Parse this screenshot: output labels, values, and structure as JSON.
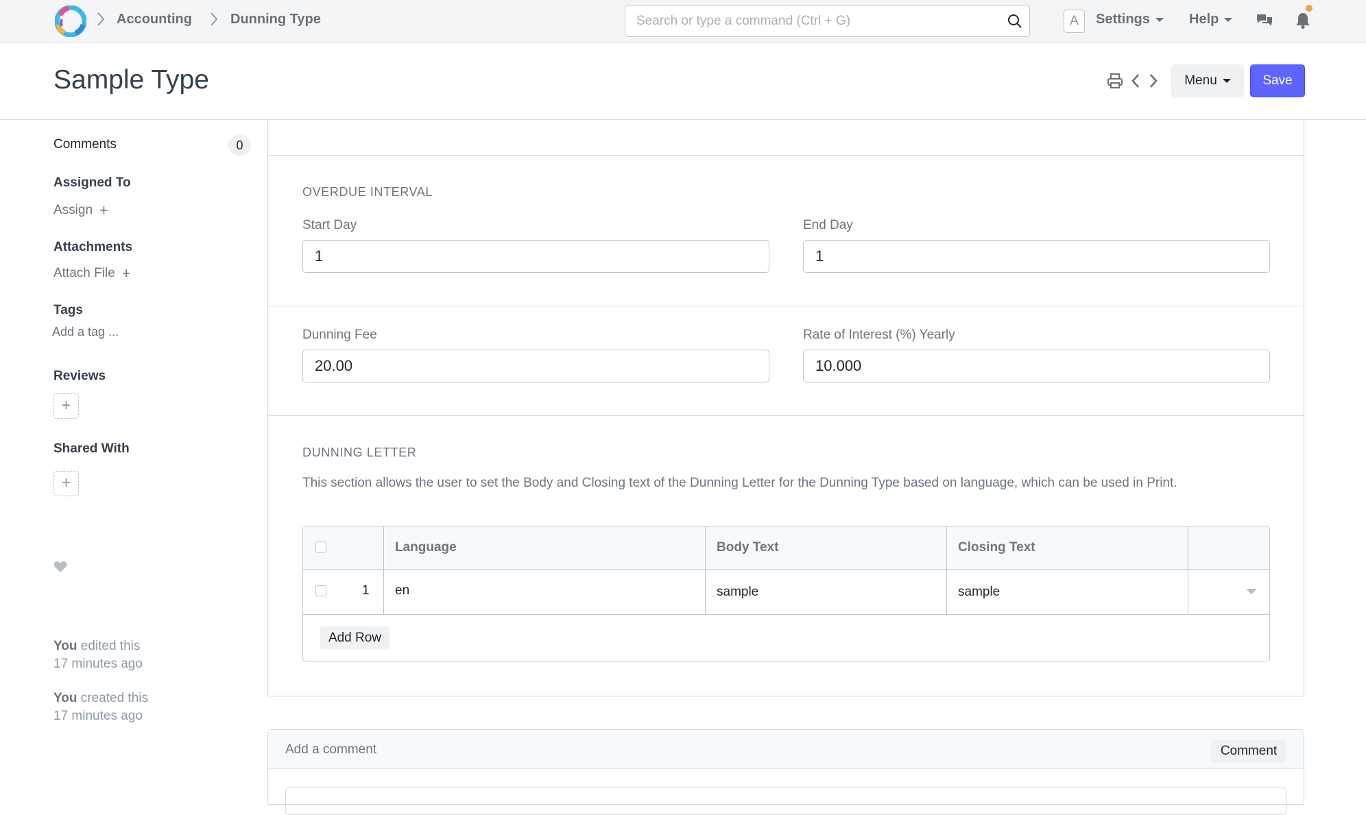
{
  "navbar": {
    "breadcrumbs": [
      "Accounting",
      "Dunning Type"
    ],
    "search_placeholder": "Search or type a command (Ctrl + G)",
    "avatar_letter": "A",
    "settings_label": "Settings",
    "help_label": "Help",
    "icons": [
      "app-logo",
      "search-icon",
      "chat-icon",
      "bell-icon"
    ],
    "notification_dot_color": "#f7a440"
  },
  "page": {
    "title": "Sample Type",
    "menu_label": "Menu",
    "save_label": "Save",
    "accent_color": "#5e64ff",
    "icons": [
      "print-icon",
      "chevron-left-icon",
      "chevron-right-icon"
    ]
  },
  "sidebar": {
    "comments_label": "Comments",
    "comments_count": "0",
    "assigned_to_label": "Assigned To",
    "assign_link": "Assign",
    "attachments_label": "Attachments",
    "attach_link": "Attach File",
    "tags_label": "Tags",
    "tag_placeholder": "Add a tag ...",
    "reviews_label": "Reviews",
    "shared_with_label": "Shared With",
    "activity": [
      {
        "who": "You",
        "action": "edited this",
        "when": "17 minutes ago"
      },
      {
        "who": "You",
        "action": "created this",
        "when": "17 minutes ago"
      }
    ]
  },
  "form": {
    "overdue_interval": {
      "title": "OVERDUE INTERVAL",
      "start_day_label": "Start Day",
      "start_day_value": "1",
      "end_day_label": "End Day",
      "end_day_value": "1"
    },
    "fees": {
      "dunning_fee_label": "Dunning Fee",
      "dunning_fee_value": "20.00",
      "rate_label": "Rate of Interest (%) Yearly",
      "rate_value": "10.000"
    },
    "dunning_letter": {
      "title": "DUNNING LETTER",
      "description": "This section allows the user to set the Body and Closing text of the Dunning Letter for the Dunning Type based on language, which can be used in Print.",
      "columns": [
        "Language",
        "Body Text",
        "Closing Text"
      ],
      "rows": [
        {
          "idx": "1",
          "language": "en",
          "body_text": "sample",
          "closing_text": "sample"
        }
      ],
      "add_row_label": "Add Row"
    }
  },
  "comment": {
    "title": "Add a comment",
    "button_label": "Comment"
  }
}
